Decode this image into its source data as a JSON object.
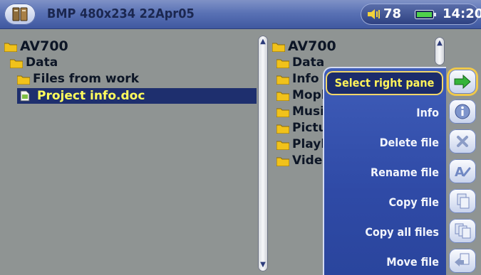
{
  "titlebar": {
    "title": "BMP 480x234 22Apr05",
    "volume": "78",
    "time": "14:20",
    "app_icon": "book-icon"
  },
  "left_pane": {
    "items": [
      {
        "label": "AV700",
        "level": 0
      },
      {
        "label": "Data",
        "level": 1
      },
      {
        "label": "Files from work",
        "level": 2
      },
      {
        "label": "Project info.doc",
        "level": 3,
        "selected": true
      }
    ]
  },
  "right_pane": {
    "items": [
      {
        "label": "AV700"
      },
      {
        "label": "Data"
      },
      {
        "label": "Info"
      },
      {
        "label": "Moph"
      },
      {
        "label": "Musi"
      },
      {
        "label": "Pictu"
      },
      {
        "label": "Playl"
      },
      {
        "label": "Vide"
      }
    ]
  },
  "menu": {
    "items": [
      {
        "label": "Select right pane",
        "icon": "green-arrows-icon",
        "active": true
      },
      {
        "label": "Info",
        "icon": "info-icon"
      },
      {
        "label": "Delete file",
        "icon": "delete-x-icon"
      },
      {
        "label": "Rename file",
        "icon": "rename-pen-icon"
      },
      {
        "label": "Copy file",
        "icon": "copy-file-icon"
      },
      {
        "label": "Copy all files",
        "icon": "copy-all-files-icon"
      },
      {
        "label": "Move file",
        "icon": "move-file-icon"
      }
    ]
  },
  "colors": {
    "title_bar": "#5a72b5",
    "pane_background": "#8f9493",
    "selected_row": "#1e2f6e",
    "selected_text": "#fffd5c",
    "menu_background": "#2f4aa6",
    "folder": "#f1c21b",
    "battery": "#4fd24a"
  }
}
